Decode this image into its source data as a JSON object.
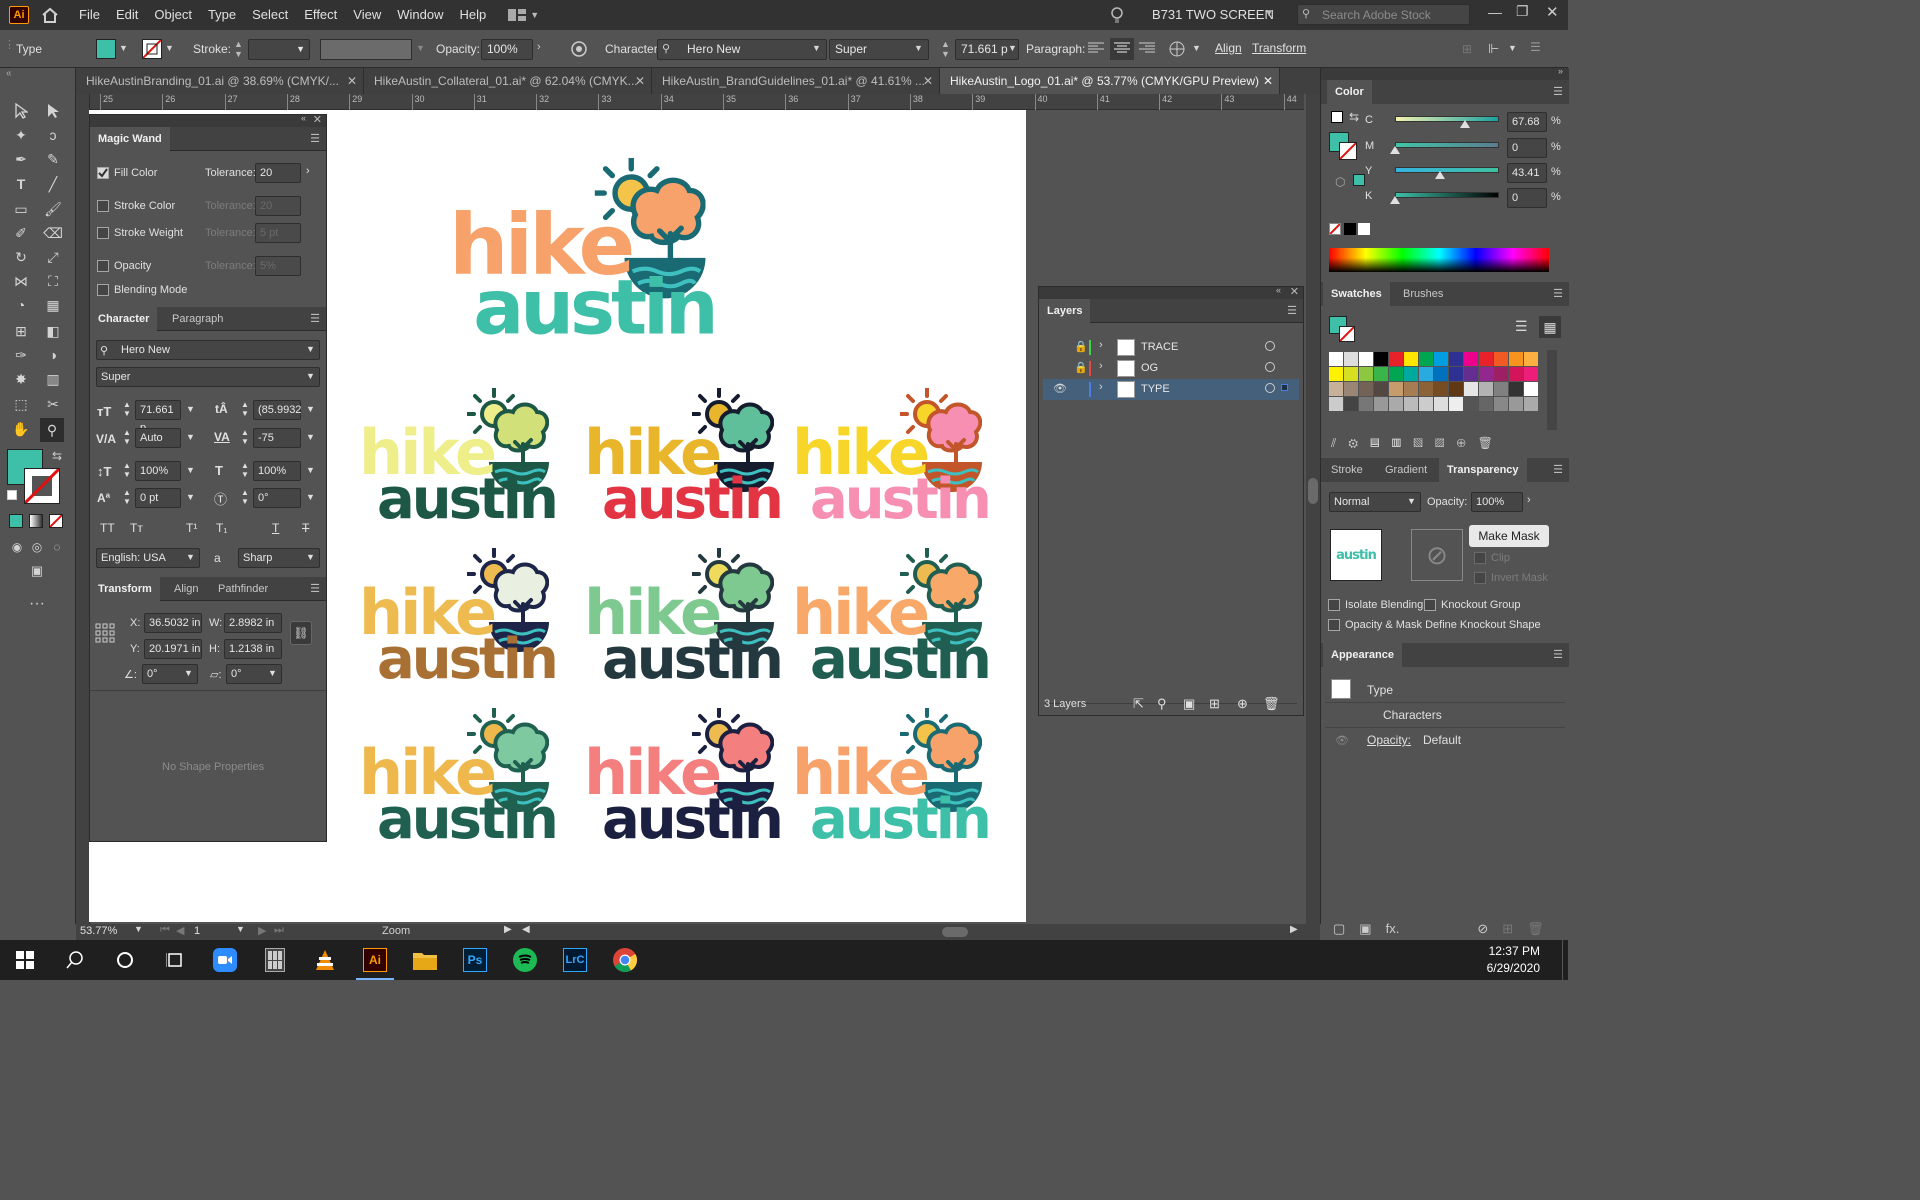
{
  "app": {
    "name": "Ai"
  },
  "menu": [
    "File",
    "Edit",
    "Object",
    "Type",
    "Select",
    "Effect",
    "View",
    "Window",
    "Help"
  ],
  "workspace": "B731 TWO SCREEN",
  "search_placeholder": "Search Adobe Stock",
  "control": {
    "tool_label": "Type",
    "stroke_label": "Stroke:",
    "opacity_label": "Opacity:",
    "opacity_value": "100%",
    "character_label": "Character:",
    "font": "Hero New",
    "style": "Super",
    "size": "71.661 p",
    "paragraph_label": "Paragraph:",
    "align_label": "Align",
    "transform_label": "Transform"
  },
  "tabs": [
    {
      "label": "HikeAustinBranding_01.ai @ 38.69% (CMYK/..."
    },
    {
      "label": "HikeAustin_Collateral_01.ai* @ 62.04% (CMYK..."
    },
    {
      "label": "HikeAustin_BrandGuidelines_01.ai* @ 41.61% ..."
    },
    {
      "label": "HikeAustin_Logo_01.ai* @ 53.77% (CMYK/GPU Preview)"
    }
  ],
  "ruler": [
    "25",
    "26",
    "27",
    "28",
    "29",
    "30",
    "31",
    "32",
    "33",
    "34",
    "35",
    "36",
    "37",
    "38",
    "39",
    "40",
    "41",
    "42",
    "43",
    "44"
  ],
  "magic_wand": {
    "title": "Magic Wand",
    "fill_color": "Fill Color",
    "tolerance_label": "Tolerance:",
    "fill_tolerance": "20",
    "stroke_color": "Stroke Color",
    "stroke_tolerance": "20",
    "stroke_weight": "Stroke Weight",
    "weight_tolerance": "5 pt",
    "opacity": "Opacity",
    "opacity_tolerance": "5%",
    "blending": "Blending Mode"
  },
  "character": {
    "tab1": "Character",
    "tab2": "Paragraph",
    "font": "Hero New",
    "style": "Super",
    "size": "71.661 p",
    "leading": "(85.9932",
    "kerning": "Auto",
    "tracking": "-75",
    "vscale": "100%",
    "hscale": "100%",
    "baseline": "0 pt",
    "rotation": "0°",
    "language": "English: USA",
    "aa_label": "a",
    "antialias": "Sharp"
  },
  "transform": {
    "tab1": "Transform",
    "tab2": "Align",
    "tab3": "Pathfinder",
    "x_label": "X:",
    "x": "36.5032 in",
    "w_label": "W:",
    "w": "2.8982 in",
    "y_label": "Y:",
    "y": "20.1971 in",
    "h_label": "H:",
    "h": "1.2138 in",
    "angle": "0°",
    "shear": "0°",
    "no_shape": "No Shape Properties"
  },
  "layers": {
    "title": "Layers",
    "items": [
      {
        "name": "TRACE",
        "color": "#3fd24a"
      },
      {
        "name": "OG",
        "color": "#e0494a"
      },
      {
        "name": "TYPE",
        "color": "#4a7fe0"
      }
    ],
    "count": "3 Layers"
  },
  "color_panel": {
    "title": "Color",
    "c_label": "C",
    "c": "67.68",
    "m_label": "M",
    "m": "0",
    "y_label": "Y",
    "y": "43.41",
    "k_label": "K",
    "k": "0",
    "pct": "%"
  },
  "swatches": {
    "tab1": "Swatches",
    "tab2": "Brushes"
  },
  "transparency": {
    "tab1": "Stroke",
    "tab2": "Gradient",
    "tab3": "Transparency",
    "mode": "Normal",
    "opacity_label": "Opacity:",
    "opacity": "100%",
    "thumb_text": "austin",
    "make_mask": "Make Mask",
    "clip": "Clip",
    "invert": "Invert Mask",
    "isolate": "Isolate Blending",
    "knockout": "Knockout Group",
    "define": "Opacity & Mask Define Knockout Shape"
  },
  "appearance": {
    "title": "Appearance",
    "type": "Type",
    "characters": "Characters",
    "opacity_label": "Opacity:",
    "opacity_value": "Default"
  },
  "status": {
    "zoom": "53.77%",
    "page": "1",
    "tool": "Zoom"
  },
  "logo_word1": "hike",
  "logo_word2": "austin",
  "logos": [
    {
      "hike": "#f7a26b",
      "austin": "#3ebfa8",
      "sun": "#f3c34a",
      "tree": "#f7a26b",
      "dark": "#1a6a73"
    },
    {
      "hike": "#eeee8a",
      "austin": "#1c5845",
      "sun": "#eeee8a",
      "tree": "#d2e07a",
      "dark": "#1c5845"
    },
    {
      "hike": "#e9b62b",
      "austin": "#e23443",
      "sun": "#e9b62b",
      "tree": "#5fbf9b",
      "dark": "#151c2e"
    },
    {
      "hike": "#f8d629",
      "austin": "#f68fb1",
      "sun": "#f8d629",
      "tree": "#f68fb1",
      "dark": "#c2562a"
    },
    {
      "hike": "#edbb4f",
      "austin": "#a87032",
      "sun": "#edbb4f",
      "tree": "#e9f0e1",
      "dark": "#1d2548"
    },
    {
      "hike": "#7ec98f",
      "austin": "#24393f",
      "sun": "#eedb5c",
      "tree": "#7ec98f",
      "dark": "#24393f"
    },
    {
      "hike": "#f8a96a",
      "austin": "#215e52",
      "sun": "#edbb4f",
      "tree": "#f8a96a",
      "dark": "#215e52"
    },
    {
      "hike": "#eeb84d",
      "austin": "#1f6050",
      "sun": "#eeb84d",
      "tree": "#7ec9a0",
      "dark": "#1f6050"
    },
    {
      "hike": "#f47f7f",
      "austin": "#1c2040",
      "sun": "#edbb4f",
      "tree": "#f47f7f",
      "dark": "#1c2040"
    },
    {
      "hike": "#f7a26b",
      "austin": "#3ebfa8",
      "sun": "#f3c34a",
      "tree": "#f7a26b",
      "dark": "#1a6a73"
    }
  ],
  "taskbar": {
    "time": "12:37 PM",
    "date": "6/29/2020"
  }
}
